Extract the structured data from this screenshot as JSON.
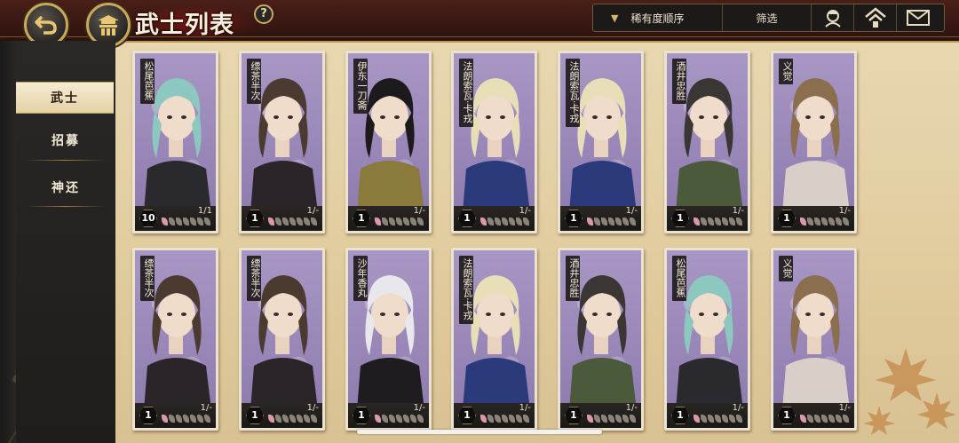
{
  "header": {
    "title": "武士列表",
    "help_label": "?"
  },
  "toolbar": {
    "sort_label": "稀有度顺序",
    "filter_label": "筛选",
    "icons": [
      "character-icon",
      "home-up-icon",
      "mail-icon"
    ]
  },
  "sidebar": {
    "items": [
      {
        "label": "武士",
        "active": true
      },
      {
        "label": "招募",
        "active": false
      },
      {
        "label": "神还",
        "active": false
      }
    ]
  },
  "cards": [
    {
      "name": "松尾芭蕉",
      "level": "10",
      "count": "1/1",
      "hair": "#8cc7c0",
      "outfit": "#2a2a2e"
    },
    {
      "name": "缥茶半次",
      "level": "1",
      "count": "1/-",
      "hair": "#4a3a30",
      "outfit": "#2b2428"
    },
    {
      "name": "伊东一刀斋",
      "level": "1",
      "count": "1/-",
      "hair": "#1c1a1c",
      "outfit": "#8a7a3c"
    },
    {
      "name": "法朗索瓦·卡戎",
      "level": "1",
      "count": "1/-",
      "hair": "#e8dfb8",
      "outfit": "#2b3a7a"
    },
    {
      "name": "法朗索瓦·卡戎",
      "level": "1",
      "count": "1/-",
      "hair": "#e8dfb8",
      "outfit": "#2b3a7a"
    },
    {
      "name": "酒井忠胜",
      "level": "1",
      "count": "1/-",
      "hair": "#3a3634",
      "outfit": "#4a5a3a"
    },
    {
      "name": "义觉",
      "level": "1",
      "count": "1/-",
      "hair": "#8a6e4e",
      "outfit": "#d8d0c8"
    },
    {
      "name": "缥茶半次",
      "level": "1",
      "count": "1/-",
      "hair": "#4a3a30",
      "outfit": "#2b2428"
    },
    {
      "name": "缥茶半次",
      "level": "1",
      "count": "1/-",
      "hair": "#4a3a30",
      "outfit": "#2b2428"
    },
    {
      "name": "沙年香丸",
      "level": "1",
      "count": "1/-",
      "hair": "#e8e8ec",
      "outfit": "#1e1c1e"
    },
    {
      "name": "法朗索瓦·卡戎",
      "level": "1",
      "count": "1/-",
      "hair": "#e8dfb8",
      "outfit": "#2b3a7a"
    },
    {
      "name": "酒井忠胜",
      "level": "1",
      "count": "1/-",
      "hair": "#3a3634",
      "outfit": "#4a5a3a"
    },
    {
      "name": "松尾芭蕉",
      "level": "1",
      "count": "1/-",
      "hair": "#8cc7c0",
      "outfit": "#2a2a2e"
    },
    {
      "name": "义觉",
      "level": "1",
      "count": "1/-",
      "hair": "#8a6e4e",
      "outfit": "#d8d0c8"
    }
  ]
}
